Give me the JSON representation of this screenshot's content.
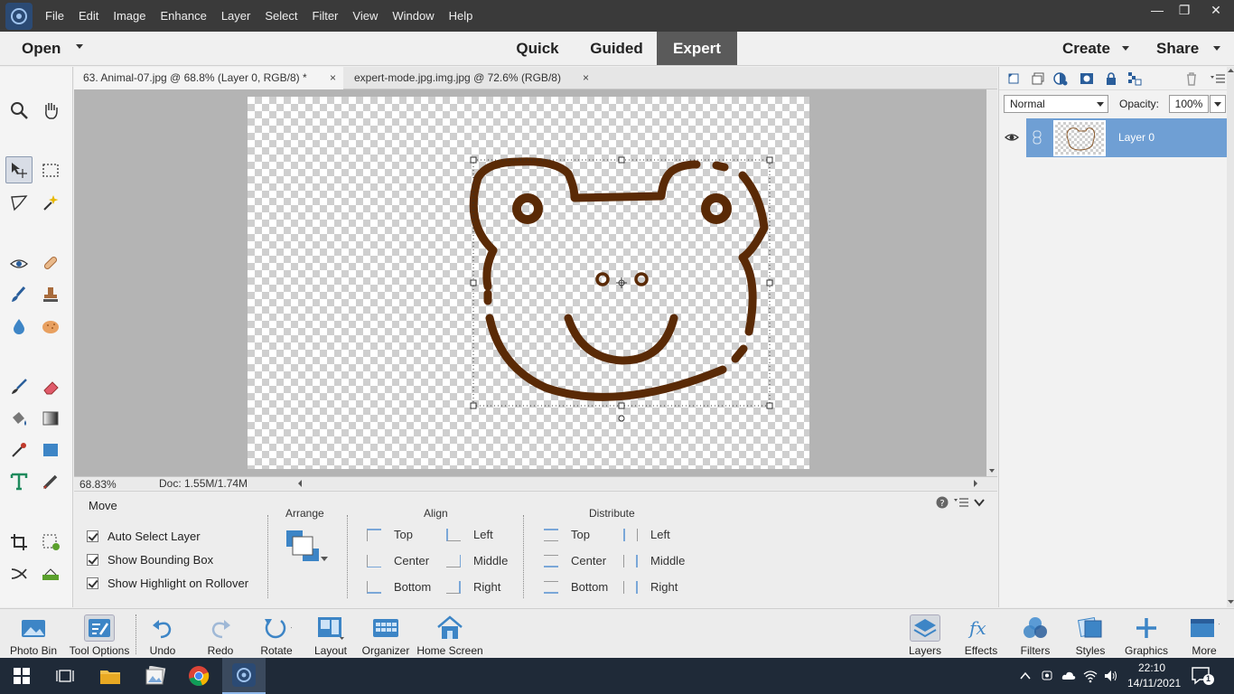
{
  "menubar": {
    "menus": [
      "File",
      "Edit",
      "Image",
      "Enhance",
      "Layer",
      "Select",
      "Filter",
      "View",
      "Window",
      "Help"
    ],
    "minimize": "—",
    "restore": "❐",
    "close": "✕"
  },
  "modebar": {
    "open_label": "Open",
    "tabs": [
      "Quick",
      "Guided",
      "Expert"
    ],
    "active_tab": "Expert",
    "create_label": "Create",
    "share_label": "Share"
  },
  "documents": {
    "tabs": [
      {
        "title": "63. Animal-07.jpg @ 68.8% (Layer 0, RGB/8) *",
        "close": "×"
      },
      {
        "title": "expert-mode.jpg.img.jpg @ 72.6% (RGB/8)",
        "close": "×"
      }
    ]
  },
  "status": {
    "zoom": "68.83%",
    "doc_size": "Doc: 1.55M/1.74M"
  },
  "tool_options": {
    "tool_name": "Move",
    "checkboxes": [
      "Auto Select Layer",
      "Show Bounding Box",
      "Show Highlight on Rollover"
    ],
    "arrange_title": "Arrange",
    "align_title": "Align",
    "distribute_title": "Distribute",
    "align": {
      "col1": [
        "Top",
        "Center",
        "Bottom"
      ],
      "col2": [
        "Left",
        "Middle",
        "Right"
      ]
    },
    "distribute": {
      "col1": [
        "Top",
        "Center",
        "Bottom"
      ],
      "col2": [
        "Left",
        "Middle",
        "Right"
      ]
    }
  },
  "layers": {
    "blend_mode": "Normal",
    "opacity_label": "Opacity:",
    "opacity_value": "100%",
    "layer_name": "Layer 0"
  },
  "bottombar": {
    "left": [
      "Photo Bin",
      "Tool Options",
      "Undo",
      "Redo",
      "Rotate",
      "Layout",
      "Organizer",
      "Home Screen"
    ],
    "right": [
      "Layers",
      "Effects",
      "Filters",
      "Styles",
      "Graphics",
      "More"
    ]
  },
  "taskbar": {
    "time": "22:10",
    "date": "14/11/2021",
    "notification_count": "1"
  },
  "colors": {
    "drawing_stroke": "#5a2a06",
    "accent_blue": "#6f9fd4",
    "menubar_bg": "#3a3a3a",
    "taskbar_bg": "#1f2a38"
  }
}
